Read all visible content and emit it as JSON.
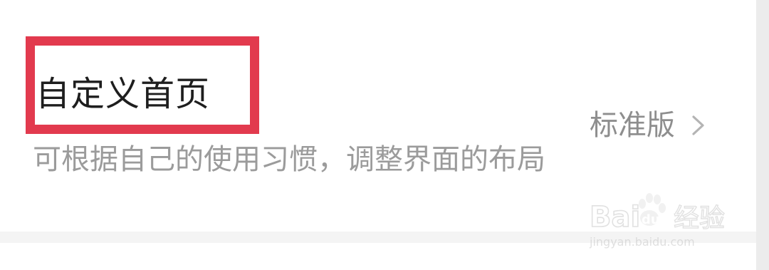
{
  "setting": {
    "title": "自定义首页",
    "description": "可根据自己的使用习惯，调整界面的布局",
    "value": "标准版"
  },
  "icons": {
    "chevron": "chevron-right-icon"
  },
  "watermark": {
    "brand_left": "Bai",
    "brand_right": "经验",
    "url": "jingyan.baidu.com"
  },
  "colors": {
    "highlight": "#e23a4e"
  }
}
